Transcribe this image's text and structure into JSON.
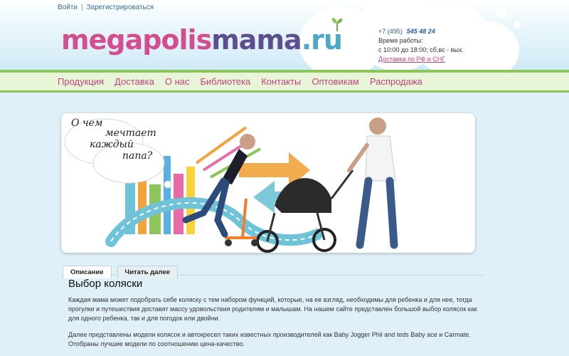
{
  "header": {
    "links": {
      "login": "Войти",
      "register": "Зарегистрироваться"
    },
    "logo": {
      "part1": "megapolis",
      "part2": "mama",
      "part3": ".ru"
    },
    "contact": {
      "phone_code": "+7 (495)",
      "phone_number": "545 48 24",
      "hours_label": "Время работы:",
      "hours": "с 10:00 до 18:00; сб,вс - вых.",
      "delivery_link": "Доставка по РФ и СНГ"
    }
  },
  "nav": {
    "items": [
      "Продукция",
      "Доставка",
      "О нас",
      "Библиотека",
      "Контакты",
      "Оптовикам",
      "Распродажа"
    ]
  },
  "banner": {
    "bubble_lines": [
      "О чем",
      "мечтает",
      "каждый",
      "папа?"
    ]
  },
  "tabs": {
    "description": "Описание",
    "read_more": "Читать далее"
  },
  "content": {
    "title": "Выбор коляски",
    "paragraph1": "Каждая мама может подобрать себе коляску с тем набором функций, которые, на ее взгляд, необходимы для ребенка и для нее, тогда прогулки и путешествия доставят массу удовольствия родителям и малышам. На нашем сайте представлен большой выбор колясок как для одного ребенка, так и для погодок или двойни.",
    "paragraph2": "Далее представлены модели колясок и автокресел таких известных производителей как Baby Jogger Phil and teds Baby ace и Carmate. Отобраны лучшие модели по соотношению цена-качество."
  },
  "colors": {
    "accent_pink": "#c2427d",
    "nav_green": "#8cc65a",
    "link_blue": "#3a6aa0"
  }
}
